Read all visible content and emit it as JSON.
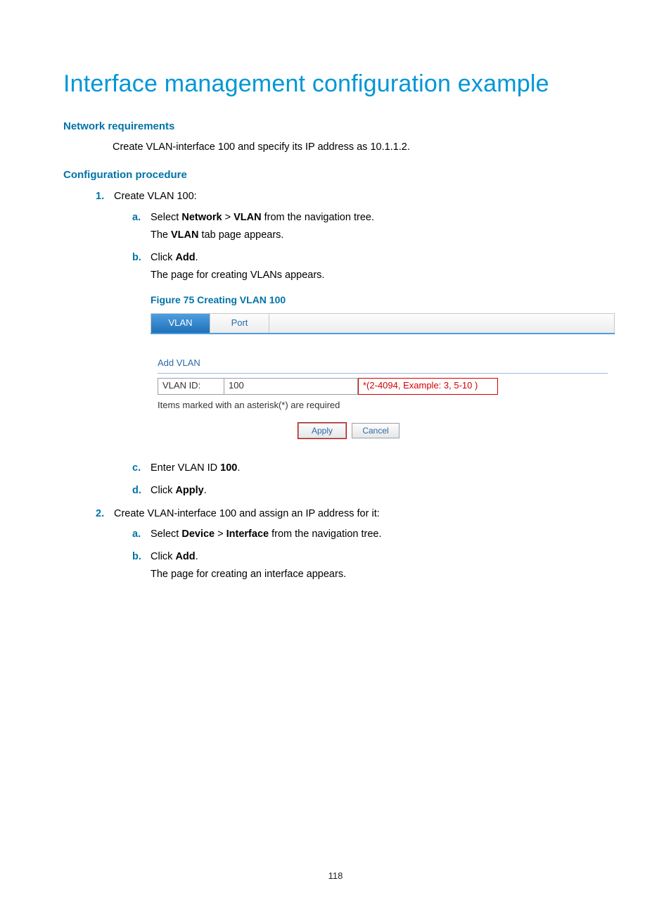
{
  "title": "Interface management configuration example",
  "sections": {
    "network_req": {
      "heading": "Network requirements",
      "text": "Create VLAN-interface 100 and specify its IP address as 10.1.1.2."
    },
    "config_proc": {
      "heading": "Configuration procedure"
    }
  },
  "steps": {
    "s1": {
      "marker": "1.",
      "text": "Create VLAN 100:",
      "a": {
        "marker": "a.",
        "line1_pre": "Select ",
        "bold1": "Network",
        "mid": " > ",
        "bold2": "VLAN",
        "line1_post": " from the navigation tree.",
        "line2_pre": "The ",
        "line2_bold": "VLAN",
        "line2_post": " tab page appears."
      },
      "b": {
        "marker": "b.",
        "pre": "Click ",
        "bold": "Add",
        "post": ".",
        "line2": "The page for creating VLANs appears."
      },
      "c": {
        "marker": "c.",
        "pre": "Enter VLAN ID ",
        "bold": "100",
        "post": "."
      },
      "d": {
        "marker": "d.",
        "pre": "Click ",
        "bold": "Apply",
        "post": "."
      }
    },
    "s2": {
      "marker": "2.",
      "text": "Create VLAN-interface 100 and assign an IP address for it:",
      "a": {
        "marker": "a.",
        "pre": "Select ",
        "bold1": "Device",
        "mid": " > ",
        "bold2": "Interface",
        "post": " from the navigation tree."
      },
      "b": {
        "marker": "b.",
        "pre": "Click ",
        "bold": "Add",
        "post": ".",
        "line2": "The page for creating an interface appears."
      }
    }
  },
  "figure": {
    "caption": "Figure 75 Creating VLAN 100",
    "tabs": {
      "vlan": "VLAN",
      "port": "Port"
    },
    "section_title": "Add VLAN",
    "label": "VLAN ID:",
    "value": "100",
    "hint": "*(2-4094, Example: 3, 5-10 )",
    "note": "Items marked with an asterisk(*) are required",
    "apply": "Apply",
    "cancel": "Cancel"
  },
  "page_number": "118"
}
